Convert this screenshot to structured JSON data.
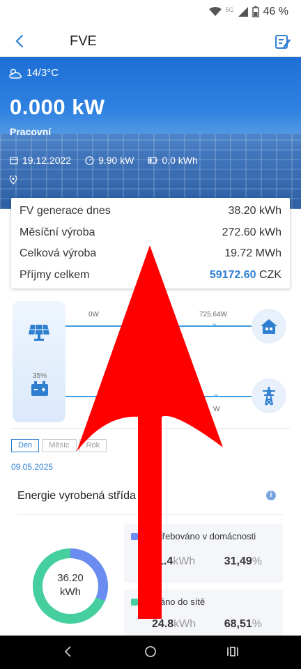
{
  "status": {
    "signal_label": "5G",
    "battery": "46 %"
  },
  "header": {
    "title": "FVE"
  },
  "hero": {
    "weather": "14/3°C",
    "power": "0.000 kW",
    "state": "Pracovní",
    "date": "19.12.2022",
    "capacity": "9.90 kW",
    "battery": "0.0 kWh"
  },
  "stats": {
    "rows": [
      {
        "label": "FV generace dnes",
        "value": "38.20 kWh"
      },
      {
        "label": "Měsíční výroba",
        "value": "272.60 kWh"
      },
      {
        "label": "Celková výroba",
        "value": "19.72 MWh"
      },
      {
        "label": "Příjmy celkem",
        "value_highlight": "59172.60",
        "value_unit": "CZK"
      }
    ]
  },
  "flow": {
    "solar_to_home": "0W",
    "home_power": "725.64W",
    "battery_percent": "35%",
    "grid_partial": "W"
  },
  "tabs": [
    "Den",
    "Měsíc",
    "Rok"
  ],
  "active_tab": "Den",
  "date": "09.05.2025",
  "energy": {
    "title": "Energie vyrobená střída",
    "donut_value": "36.20",
    "donut_unit": "kWh",
    "consumed": {
      "label": "Spotřebováno v domácnosti",
      "kwh": "11.4",
      "unit": "kWh",
      "pct": "31,49",
      "pct_unit": "%"
    },
    "fed": {
      "label": "Dodáno do sítě",
      "kwh": "24.8",
      "unit": "kWh",
      "pct": "68,51",
      "pct_unit": "%"
    },
    "consumed_fraction": 0.3149,
    "colors": {
      "consumed": "#6b8cf0",
      "fed": "#45cf9e"
    }
  },
  "colors": {
    "accent": "#2f7fd1",
    "arrow": "#ff0000"
  }
}
